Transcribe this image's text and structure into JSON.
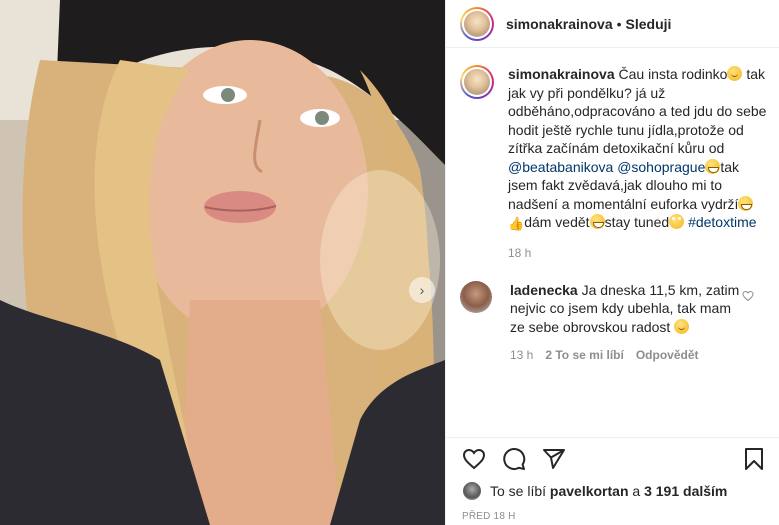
{
  "post": {
    "username": "simonakrainova",
    "dot": "•",
    "follow_label": "Sleduji",
    "caption": {
      "p1": "Čau insta rodinko",
      "p2": "tak jak vy při pondělku? já už odběháno,odpracováno a ted jdu do sebe hodit ještě rychle tunu jídla,protože od zítřka začínám detoxikační kůru od",
      "mention1": "@beatabanikova",
      "mention2": "@sohoprague",
      "p3": "tak jsem fakt zvědavá,jak dlouho mi to nadšení a momentální euforka vydrží",
      "p4": "dám vedět",
      "p5": "stay tuned",
      "hashtag": "#detoxtime"
    },
    "caption_time": "18 h"
  },
  "comment": {
    "username": "ladenecka",
    "text": "Ja dneska 11,5 km, zatim nejvic co jsem kdy ubehla, tak mam ze sebe obrovskou radost",
    "time": "13 h",
    "likes": "2 To se mi líbí",
    "reply": "Odpovědět"
  },
  "likes": {
    "prefix": "To se líbí",
    "user": "pavelkortan",
    "middle": "a",
    "others": "3 191 dalším"
  },
  "posted_time": "PŘED 18 H",
  "icons": [
    "heart-icon",
    "comment-icon",
    "share-icon",
    "bookmark-icon",
    "chevron-right-icon"
  ],
  "colors": {
    "link": "#00376b",
    "muted": "#8e8e8e",
    "text": "#262626"
  }
}
